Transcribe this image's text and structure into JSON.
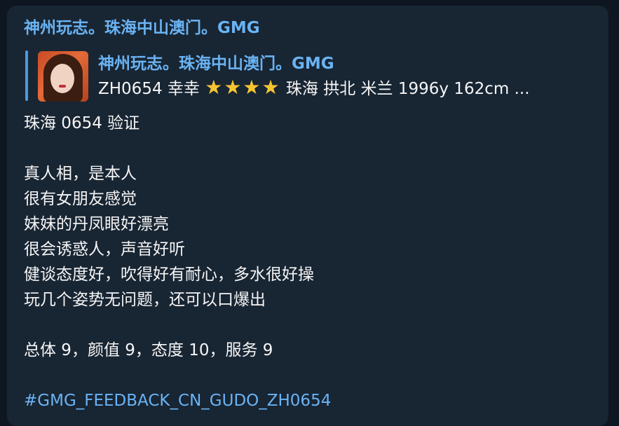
{
  "message": {
    "sender": "神州玩志。珠海中山澳门。GMG",
    "reply": {
      "title": "神州玩志。珠海中山澳门。GMG",
      "desc_prefix": "ZH0654 幸幸 ",
      "stars": "★★★★",
      "desc_suffix": " 珠海 拱北 米兰 1996y  162cm ..."
    },
    "lines": [
      "珠海 0654 验证",
      "",
      "真人相，是本人",
      "很有女朋友感觉",
      "妹妹的丹凤眼好漂亮",
      "很会诱惑人，声音好听",
      "健谈态度好，吹得好有耐心，多水很好操",
      "玩几个姿势无问题，还可以口爆出",
      "",
      "总体 9，颜值 9，态度 10，服务 9",
      ""
    ],
    "hashtag": "#GMG_FEEDBACK_CN_GUDO_ZH0654"
  },
  "colors": {
    "background": "#0e1621",
    "bubble": "#182533",
    "accent": "#6ab3f3",
    "text": "#f5f5f5",
    "star": "#f7c531"
  }
}
